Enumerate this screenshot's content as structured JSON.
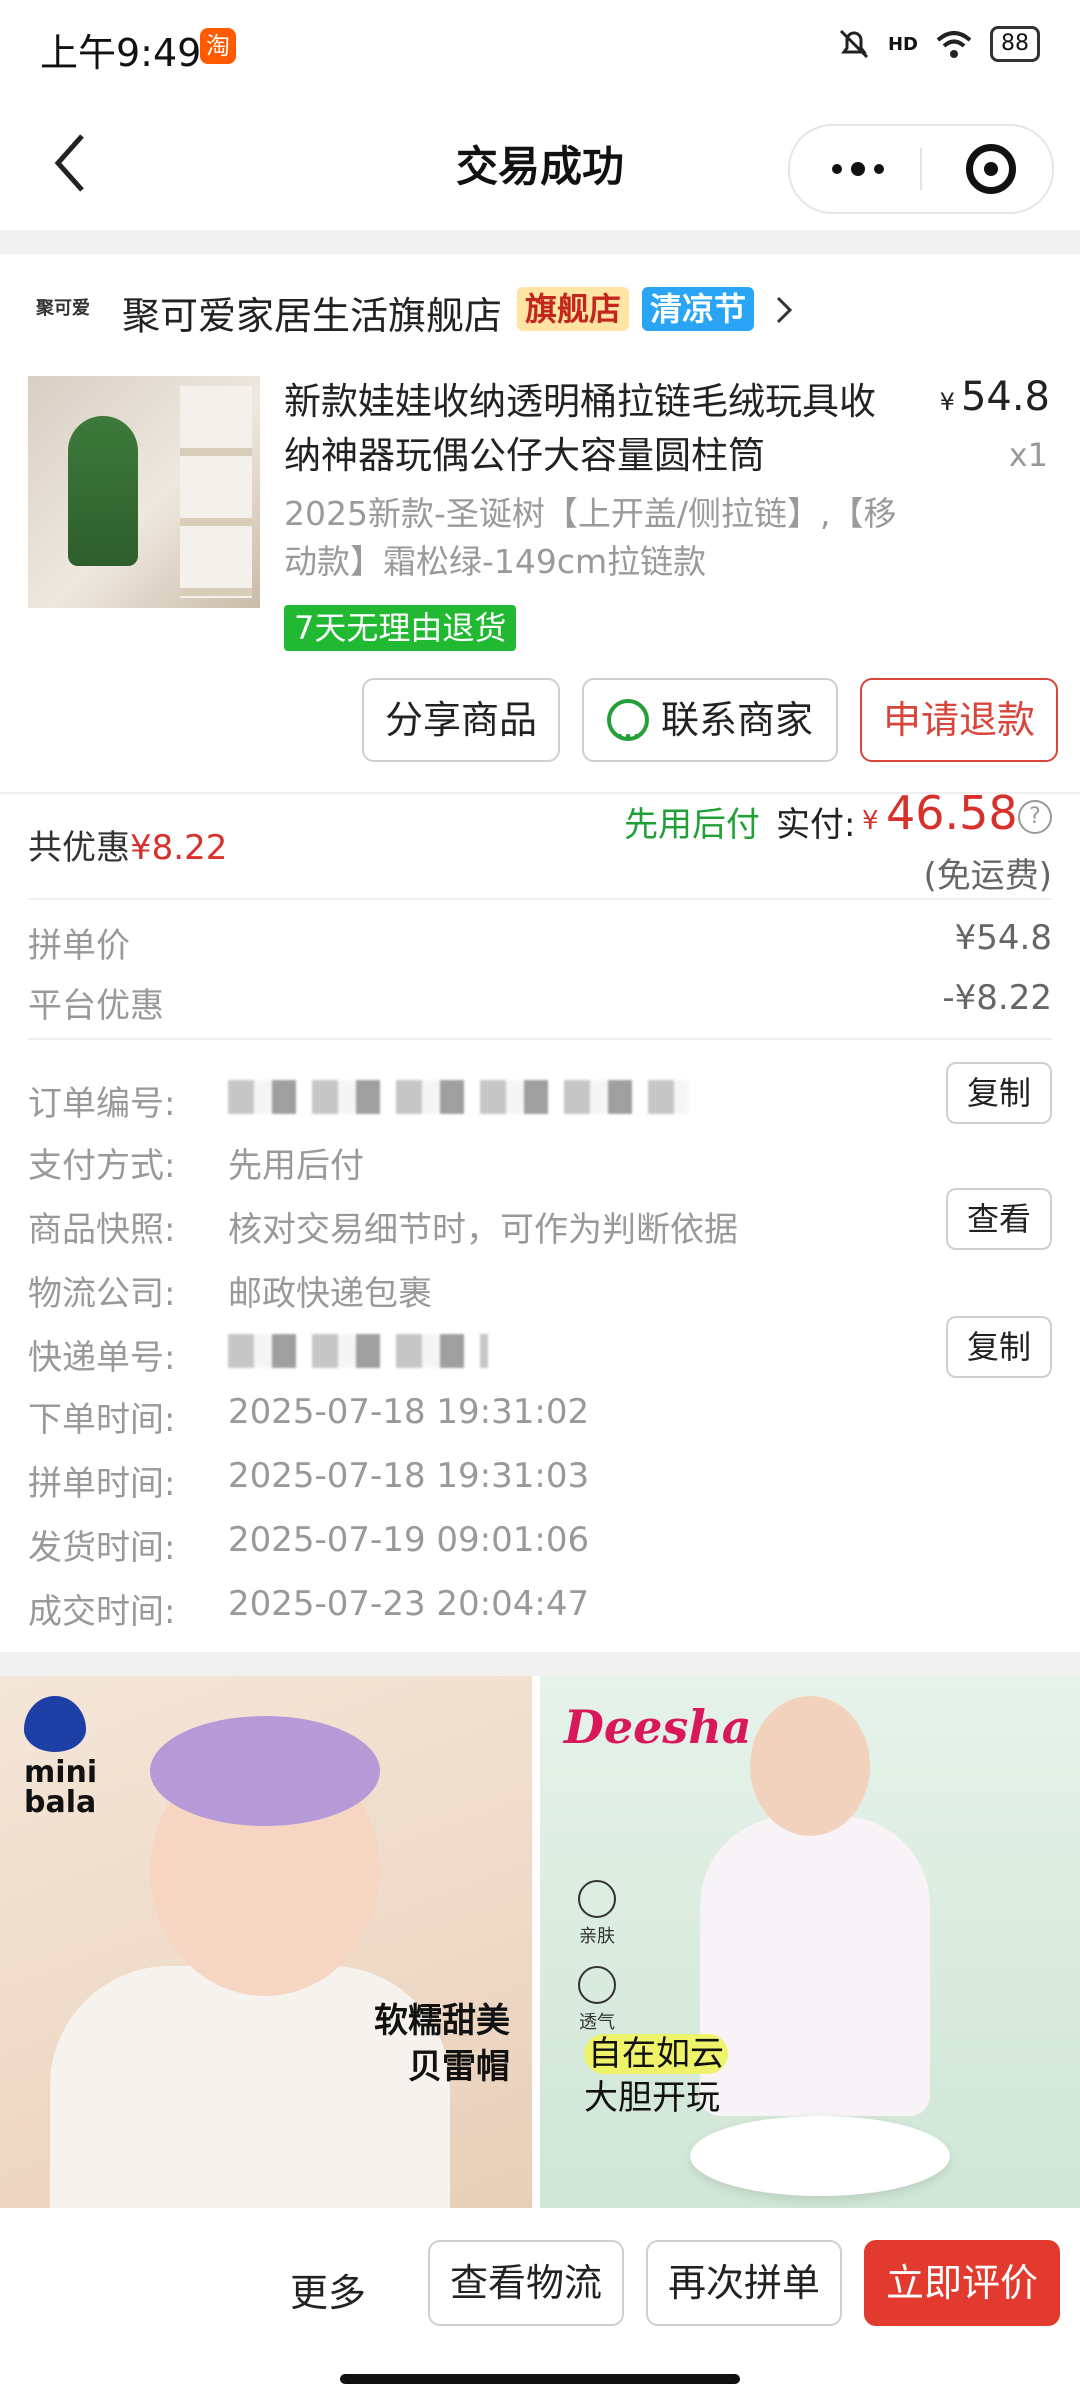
{
  "status_bar": {
    "time": "上午9:49",
    "app_badge": "淘",
    "signal_label": "HD",
    "battery": "88"
  },
  "nav": {
    "title": "交易成功"
  },
  "store": {
    "logo_text": "聚可爱",
    "name": "聚可爱家居生活旗舰店",
    "tag_flagship": "旗舰店",
    "tag_event": "清凉节"
  },
  "product": {
    "title": "新款娃娃收纳透明桶拉链毛绒玩具收纳神器玩偶公仔大容量圆柱筒",
    "price_currency": "¥",
    "price": "54.8",
    "quantity": "x1",
    "spec": "2025新款-圣诞树【上开盖/侧拉链】,【移动款】霜松绿-149cm拉链款",
    "return_policy": "7天无理由退货"
  },
  "actions": {
    "share": "分享商品",
    "contact": "联系商家",
    "refund": "申请退款"
  },
  "payment": {
    "discount_label": "共优惠",
    "discount_value": "¥8.22",
    "pay_later": "先用后付",
    "paid_label": "实付:",
    "paid_currency": "¥",
    "paid_value": "46.58",
    "help": "?",
    "free_shipping": "(免运费)",
    "group_price_label": "拼单价",
    "group_price_value": "¥54.8",
    "platform_discount_label": "平台优惠",
    "platform_discount_value": "-¥8.22"
  },
  "order_details": {
    "order_no_label": "订单编号:",
    "copy_label": "复制",
    "pay_method_label": "支付方式:",
    "pay_method_value": "先用后付",
    "snapshot_label": "商品快照:",
    "snapshot_value": "核对交易细节时，可作为判断依据",
    "view_label": "查看",
    "logistics_label": "物流公司:",
    "logistics_value": "邮政快递包裹",
    "tracking_label": "快递单号:",
    "order_time_label": "下单时间:",
    "order_time_value": "2025-07-18 19:31:02",
    "group_time_label": "拼单时间:",
    "group_time_value": "2025-07-18 19:31:03",
    "ship_time_label": "发货时间:",
    "ship_time_value": "2025-07-19 09:01:06",
    "deal_time_label": "成交时间:",
    "deal_time_value": "2025-07-23 20:04:47"
  },
  "ads": {
    "left_brand_line1": "mini",
    "left_brand_line2": "bala",
    "left_slogan_line1": "软糯甜美",
    "left_slogan_line2": "贝雷帽",
    "right_brand": "Deesha",
    "right_feature1": "亲肤",
    "right_feature2": "透气",
    "right_slogan_line1": "自在如云",
    "right_slogan_line2": "大胆开玩"
  },
  "bottom_bar": {
    "more": "更多",
    "logistics": "查看物流",
    "reorder": "再次拼单",
    "review": "立即评价"
  },
  "colors": {
    "accent_red": "#e23a2e",
    "price_red": "#d8302b",
    "green": "#21b832"
  }
}
